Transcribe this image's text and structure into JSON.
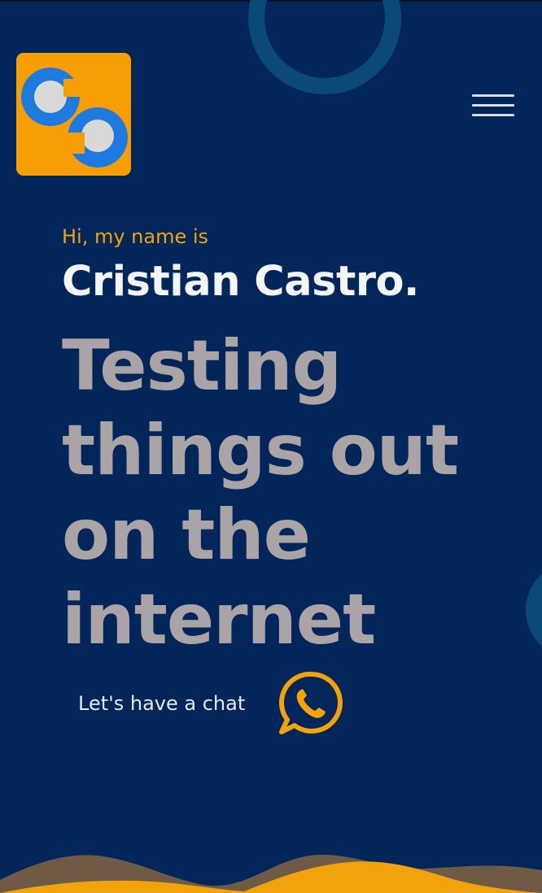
{
  "hero": {
    "greeting": "Hi, my name is",
    "name": "Cristian Castro.",
    "headline_lines": [
      "Testing",
      "things out",
      "on the",
      "internet"
    ]
  },
  "cta": {
    "label": "Let's have a chat",
    "icon": "whatsapp-icon"
  },
  "header": {
    "logo_icon": "cc-logo-icon",
    "menu_icon": "hamburger-menu-icon"
  },
  "colors": {
    "background": "#02265a",
    "accent": "#f2a20a",
    "logo_blue": "#1f7ae0",
    "headline": "#aaa4a7",
    "ring": "#0b4a78"
  }
}
